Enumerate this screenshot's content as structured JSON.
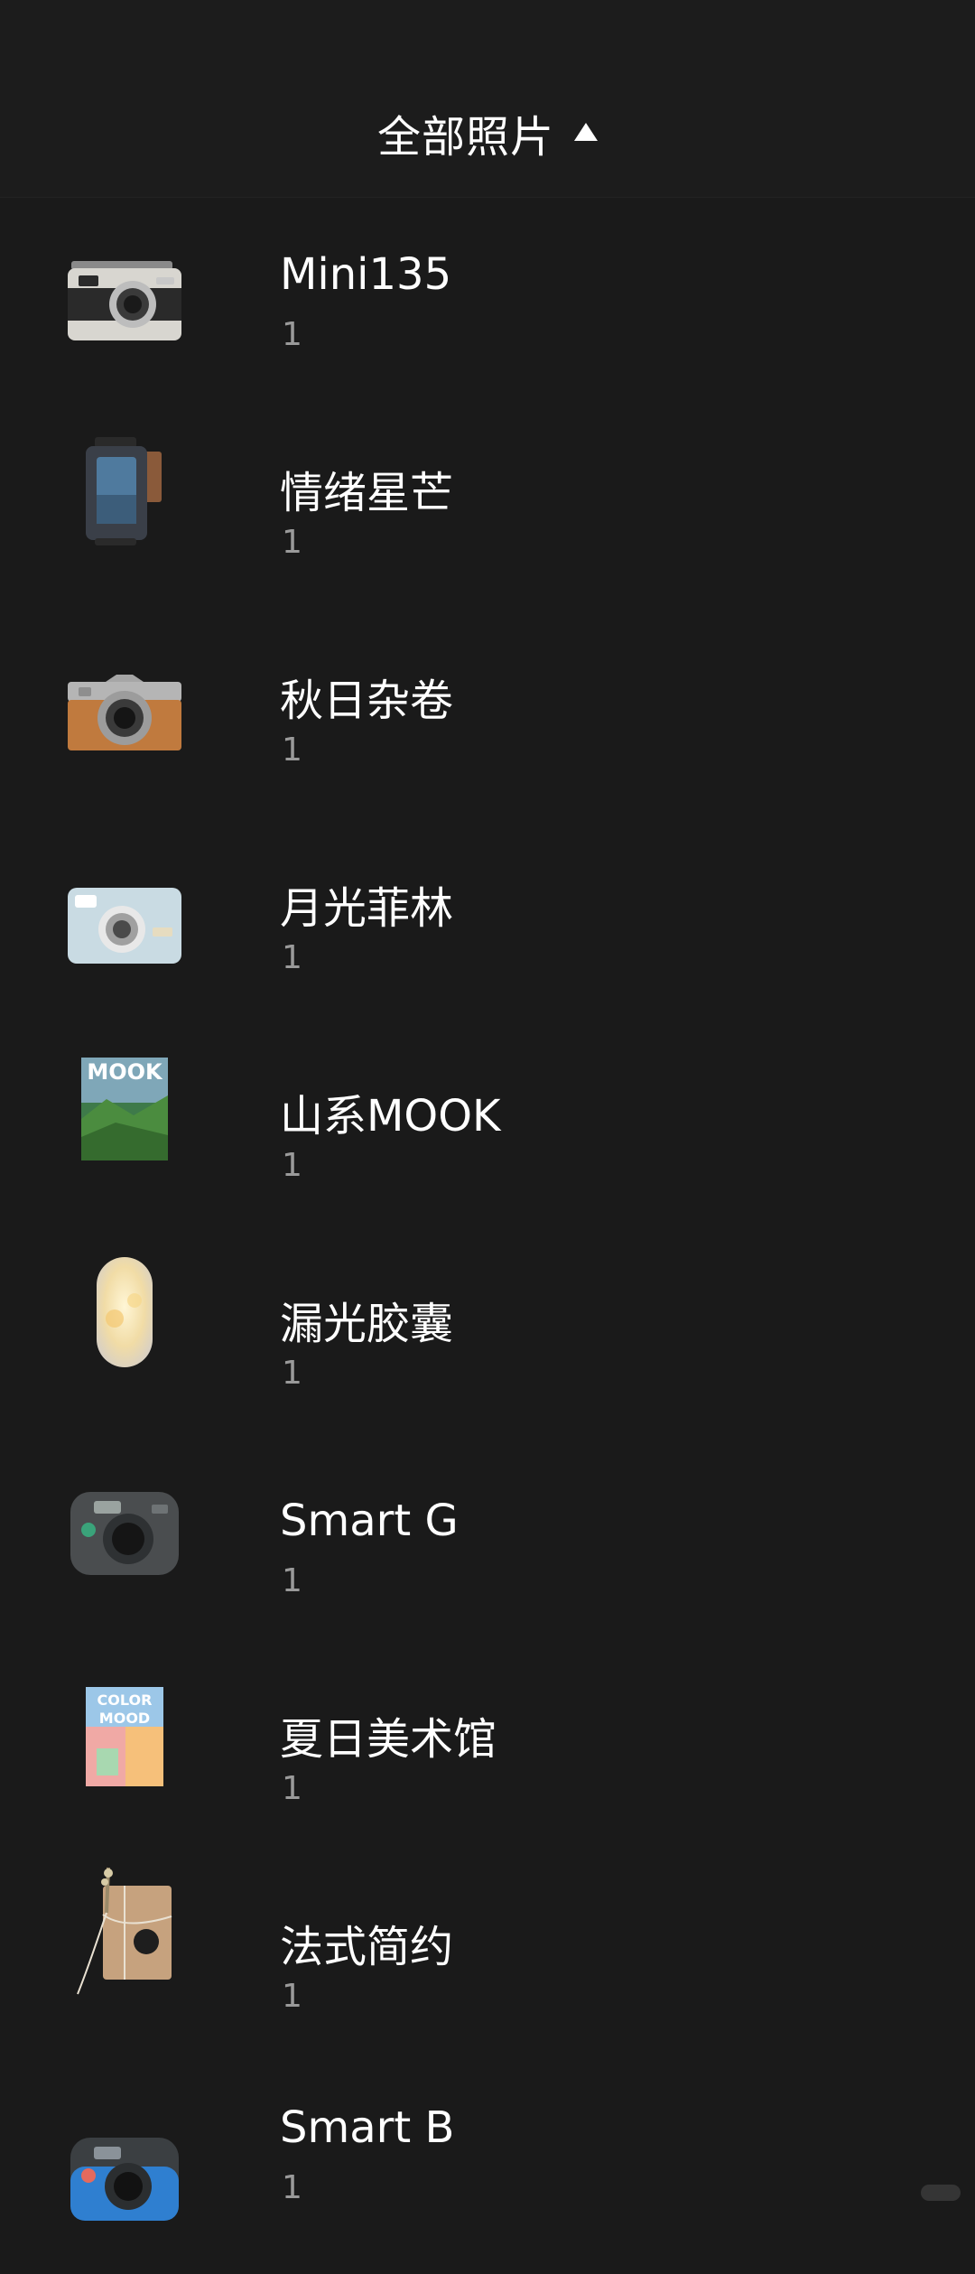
{
  "header": {
    "title": "全部照片",
    "toggle_icon": "triangle-up-icon"
  },
  "albums": [
    {
      "name": "Mini135",
      "count": "1",
      "icon": "silver-compact-camera-icon"
    },
    {
      "name": "情绪星芒",
      "count": "1",
      "icon": "film-canister-icon"
    },
    {
      "name": "秋日杂卷",
      "count": "1",
      "icon": "brown-rangefinder-camera-icon"
    },
    {
      "name": "月光菲林",
      "count": "1",
      "icon": "light-blue-compact-camera-icon"
    },
    {
      "name": "山系MOOK",
      "count": "1",
      "icon": "mook-magazine-icon",
      "cover_text": "MOOK"
    },
    {
      "name": "漏光胶囊",
      "count": "1",
      "icon": "light-leak-capsule-icon"
    },
    {
      "name": "Smart G",
      "count": "1",
      "icon": "gray-instant-camera-icon"
    },
    {
      "name": "夏日美术馆",
      "count": "1",
      "icon": "color-mood-book-icon",
      "cover_text": "COLOR MOOD"
    },
    {
      "name": "法式简约",
      "count": "1",
      "icon": "kraft-paper-package-icon"
    },
    {
      "name": "Smart B",
      "count": "1",
      "icon": "blue-instant-camera-icon"
    }
  ]
}
